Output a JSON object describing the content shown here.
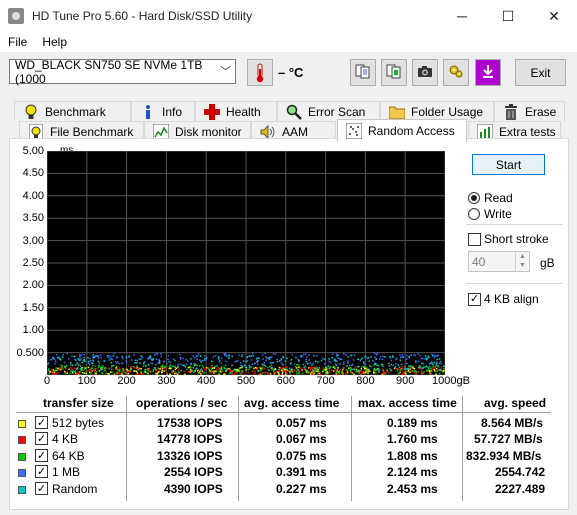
{
  "window": {
    "title": "HD Tune Pro 5.60 - Hard Disk/SSD Utility",
    "minimize_glyph": "─",
    "maximize_glyph": "☐",
    "close_glyph": "✕"
  },
  "menu": {
    "items": [
      "File",
      "Help"
    ]
  },
  "toolbar": {
    "drive": "WD_BLACK SN750 SE NVMe 1TB (1000",
    "temperature": "– °C",
    "exit_label": "Exit",
    "icons": [
      "copy-text-icon",
      "copy-screenshot-icon",
      "camera-icon",
      "options-icon",
      "save-icon"
    ]
  },
  "tabs": {
    "row1": [
      "Benchmark",
      "Info",
      "Health",
      "Error Scan",
      "Folder Usage",
      "Erase"
    ],
    "row2": [
      "File Benchmark",
      "Disk monitor",
      "AAM",
      "Random Access",
      "Extra tests"
    ],
    "active": "Random Access"
  },
  "chart_data": {
    "type": "scatter",
    "ylabel": "ms",
    "y_ticks": [
      "5.00",
      "4.50",
      "4.00",
      "3.50",
      "3.00",
      "2.50",
      "2.00",
      "1.50",
      "1.00",
      "0.500"
    ],
    "x_ticks": [
      "0",
      "100",
      "200",
      "300",
      "400",
      "500",
      "600",
      "700",
      "800",
      "900",
      "1000gB"
    ],
    "xlim": [
      0,
      1000
    ],
    "ylim": [
      0,
      5
    ],
    "grid": true,
    "background": "#000000",
    "grid_color": "#555555",
    "series": [
      {
        "name": "512 bytes",
        "color": "#ffff00",
        "y_band": [
          0.03,
          0.19
        ]
      },
      {
        "name": "4 KB",
        "color": "#ff0000",
        "y_band": [
          0.03,
          0.2
        ]
      },
      {
        "name": "64 KB",
        "color": "#00cc00",
        "y_band": [
          0.05,
          0.25
        ]
      },
      {
        "name": "1 MB",
        "color": "#3a6cff",
        "y_band": [
          0.25,
          0.5
        ]
      },
      {
        "name": "Random",
        "color": "#00cccc",
        "y_band": [
          0.1,
          0.45
        ]
      }
    ]
  },
  "controls": {
    "start_label": "Start",
    "read_label": "Read",
    "write_label": "Write",
    "mode": "Read",
    "short_stroke_label": "Short stroke",
    "short_stroke_checked": false,
    "short_stroke_value": "40",
    "short_stroke_unit": "gB",
    "align_label": "4 KB align",
    "align_checked": true
  },
  "results": {
    "headers": [
      "transfer size",
      "operations / sec",
      "avg. access time",
      "max. access time",
      "avg. speed"
    ],
    "rows": [
      {
        "size": "512 bytes",
        "color": "#ffff00",
        "ops": "17538 IOPS",
        "avg": "0.057 ms",
        "max": "0.189 ms",
        "speed": "8.564 MB/s"
      },
      {
        "size": "4 KB",
        "color": "#ff0000",
        "ops": "14778 IOPS",
        "avg": "0.067 ms",
        "max": "1.760 ms",
        "speed": "57.727 MB/s"
      },
      {
        "size": "64 KB",
        "color": "#00cc00",
        "ops": "13326 IOPS",
        "avg": "0.075 ms",
        "max": "1.808 ms",
        "speed": "832.934 MB/s"
      },
      {
        "size": "1 MB",
        "color": "#3a6cff",
        "ops": "2554 IOPS",
        "avg": "0.391 ms",
        "max": "2.124 ms",
        "speed": "2554.742"
      },
      {
        "size": "Random",
        "color": "#00cccc",
        "ops": "4390 IOPS",
        "avg": "0.227 ms",
        "max": "2.453 ms",
        "speed": "2227.489"
      }
    ]
  }
}
